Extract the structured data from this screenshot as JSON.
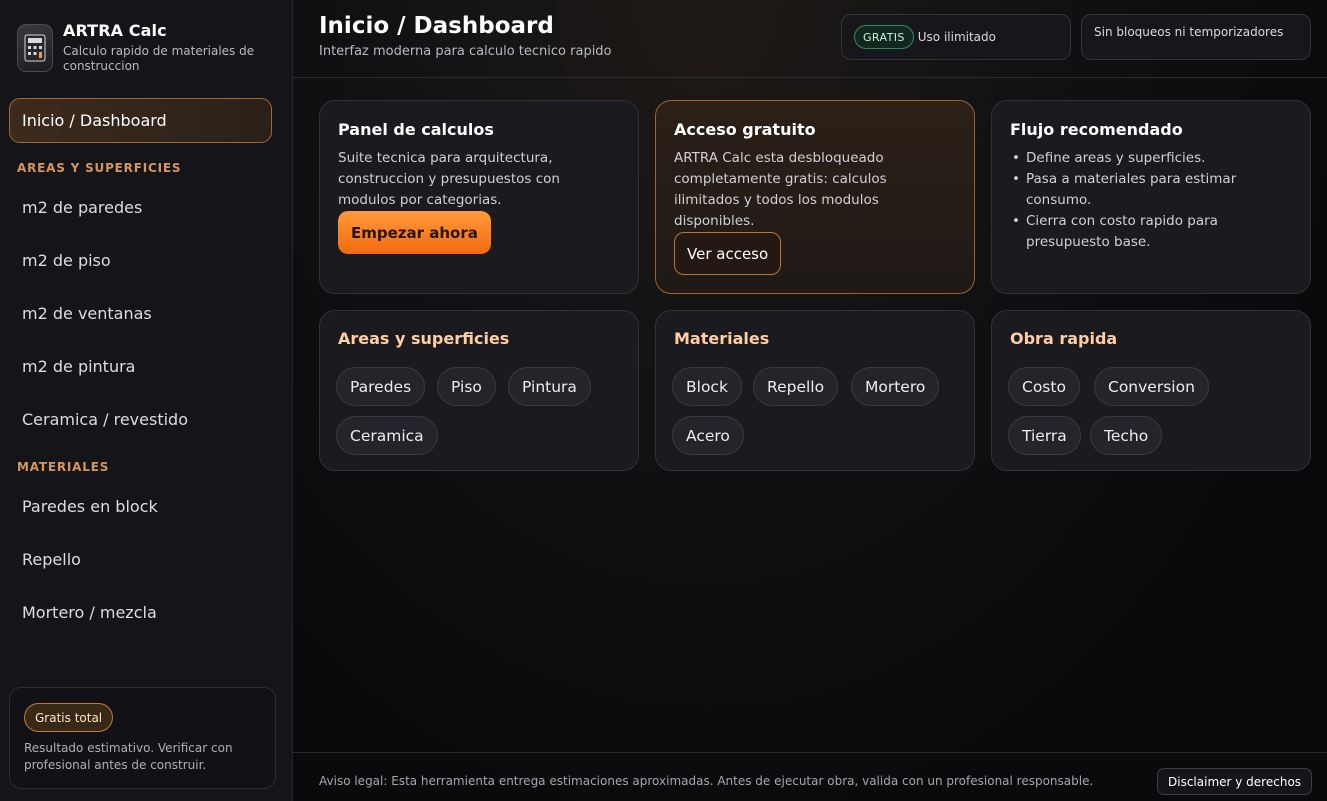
{
  "brand": {
    "title": "ARTRA Calc",
    "subtitle": "Calculo rapido de materiales de construccion",
    "logo_icon": "calculator-ruler-icon"
  },
  "sidebar": {
    "active_item": "Inicio / Dashboard",
    "sections": [
      {
        "label": "AREAS Y SUPERFICIES",
        "items": [
          "m2 de paredes",
          "m2 de piso",
          "m2 de ventanas",
          "m2 de pintura",
          "Ceramica / revestido"
        ]
      },
      {
        "label": "MATERIALES",
        "items": [
          "Paredes en block",
          "Repello",
          "Mortero / mezcla"
        ]
      }
    ],
    "footer_card": {
      "badge": "Gratis total",
      "note": "Resultado estimativo. Verificar con profesional antes de construir."
    }
  },
  "header": {
    "title": "Inicio / Dashboard",
    "subtitle": "Interfaz moderna para calculo tecnico rapido",
    "usage_chip": {
      "tag": "GRATIS",
      "text": "Uso ilimitado"
    },
    "nolock_chip": "Sin bloqueos ni temporizadores"
  },
  "cards": {
    "panel": {
      "title": "Panel de calculos",
      "body": "Suite tecnica para arquitectura, construccion y presupuestos con modulos por categorias.",
      "button": "Empezar ahora"
    },
    "access": {
      "title": "Acceso gratuito",
      "body": "ARTRA Calc esta desbloqueado completamente gratis: calculos ilimitados y todos los modulos disponibles.",
      "button": "Ver acceso"
    },
    "flow": {
      "title": "Flujo recomendado",
      "steps": [
        "Define areas y superficies.",
        "Pasa a materiales para estimar consumo.",
        "Cierra con costo rapido para presupuesto base."
      ]
    },
    "areas": {
      "title": "Areas y superficies",
      "tags": [
        "Paredes",
        "Piso",
        "Pintura",
        "Ceramica"
      ]
    },
    "materials": {
      "title": "Materiales",
      "tags": [
        "Block",
        "Repello",
        "Mortero",
        "Acero"
      ]
    },
    "quick": {
      "title": "Obra rapida",
      "tags": [
        "Costo",
        "Conversion",
        "Tierra",
        "Techo"
      ]
    }
  },
  "footer": {
    "notice": "Aviso legal: Esta herramienta entrega estimaciones aproximadas. Antes de ejecutar obra, valida con un profesional responsable.",
    "button": "Disclaimer y derechos"
  },
  "colors": {
    "accent": "#f27a1f",
    "accent_border": "#a7662c",
    "section_label": "#d49560",
    "success": "#2f8a62"
  }
}
